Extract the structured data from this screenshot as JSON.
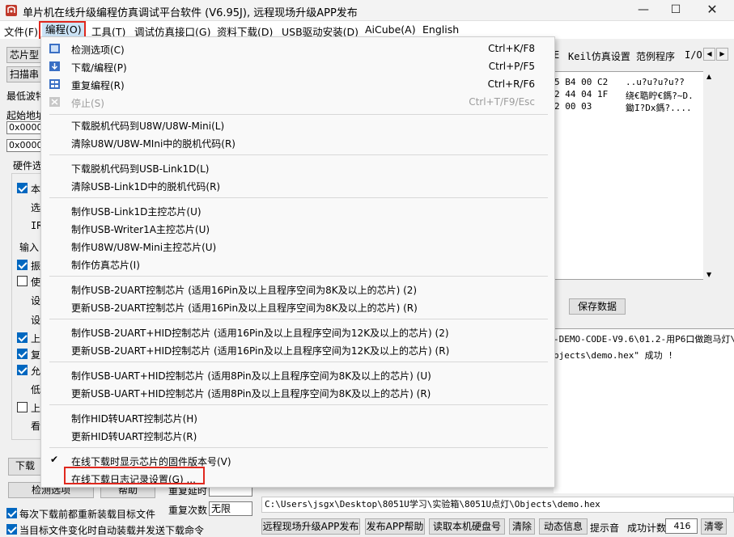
{
  "window": {
    "title": "单片机在线升级编程仿真调试平台软件 (V6.95J), 远程现场升级APP发布",
    "min_glyph": "—",
    "max_glyph": "☐",
    "close_glyph": "✕"
  },
  "menubar": [
    "文件(F)",
    "编程(O)",
    "工具(T)",
    "调试仿真接口(G)",
    "资料下载(D)",
    "USB驱动安装(D)",
    "AiCube(A)",
    "English"
  ],
  "left_panel": {
    "chip_label": "芯片型",
    "scan_label": "扫描串",
    "min_wave_label": "最低波特",
    "start_addr_label": "起始地址",
    "addr_value_1": "0x0000",
    "addr_value_2": "0x0000",
    "hardware_tab": "硬件选",
    "group_items": [
      "本",
      "选",
      "IR",
      "输入",
      "振",
      "使",
      "设",
      "设",
      "上",
      "复",
      "允",
      "低",
      "上",
      "看"
    ],
    "download_btn": "下载",
    "check_btn": "检测选项",
    "help_btn": "帮助",
    "retry_delay_label": "重复延时",
    "retry_count_label": "重复次数",
    "retry_count_value": "无限",
    "reload_each_label": "每次下载前都重新装载目标文件",
    "auto_reload_label": "当目标文件变化时自动装载并发送下载命令"
  },
  "right_panel": {
    "tabs": [
      "E",
      "Keil仿真设置",
      "范例程序",
      "I/O"
    ],
    "hex_rows": [
      {
        "hex": "5 B4 00 C2",
        "ascii": "..u?u?u?u??"
      },
      {
        "hex": "2 44 04 1F",
        "ascii": "绕€聕眝€鎷?~D."
      },
      {
        "hex": "2 00 03",
        "ascii": "鋤I?Dx鎷?...."
      }
    ],
    "save_button": "保存数据",
    "log_lines": [
      "-DEMO-CODE-V9.6\\01.2-用P6口做跑马灯\\",
      "bjects\\demo.hex\" 成功 !"
    ],
    "file_path": "C:\\Users\\jsgx\\Desktop\\8051U学习\\实验箱\\8051U点灯\\Objects\\demo.hex"
  },
  "bottom_bar": {
    "buttons": [
      "远程现场升级APP发布",
      "发布APP帮助",
      "读取本机硬盘号",
      "清除",
      "动态信息"
    ],
    "beep_label": "提示音",
    "success_label": "成功计数",
    "success_count": "416",
    "clear_button": "清零"
  },
  "dropdown": {
    "items": [
      {
        "label": "检测选项(C)",
        "shortcut": "Ctrl+K/F8",
        "icon": "detect-icon"
      },
      {
        "label": "下载/编程(P)",
        "shortcut": "Ctrl+P/F5",
        "icon": "download-icon"
      },
      {
        "label": "重复编程(R)",
        "shortcut": "Ctrl+R/F6",
        "icon": "repeat-icon"
      },
      {
        "label": "停止(S)",
        "shortcut": "Ctrl+T/F9/Esc",
        "icon": "stop-icon",
        "disabled": true
      },
      {
        "label": "下载脱机代码到U8W/U8W-Mini(L)"
      },
      {
        "label": "清除U8W/U8W-MIni中的脱机代码(R)"
      },
      {
        "label": "下载脱机代码到USB-Link1D(L)"
      },
      {
        "label": "清除USB-Link1D中的脱机代码(R)"
      },
      {
        "label": "制作USB-Link1D主控芯片(U)"
      },
      {
        "label": "制作USB-Writer1A主控芯片(U)"
      },
      {
        "label": "制作U8W/U8W-Mini主控芯片(U)"
      },
      {
        "label": "制作仿真芯片(I)"
      },
      {
        "label": "制作USB-2UART控制芯片 (适用16Pin及以上且程序空间为8K及以上的芯片) (2)"
      },
      {
        "label": "更新USB-2UART控制芯片 (适用16Pin及以上且程序空间为8K及以上的芯片) (R)"
      },
      {
        "label": "制作USB-2UART+HID控制芯片 (适用16Pin及以上且程序空间为12K及以上的芯片) (2)"
      },
      {
        "label": "更新USB-2UART+HID控制芯片 (适用16Pin及以上且程序空间为12K及以上的芯片) (R)"
      },
      {
        "label": "制作USB-UART+HID控制芯片 (适用8Pin及以上且程序空间为8K及以上的芯片) (U)"
      },
      {
        "label": "更新USB-UART+HID控制芯片 (适用8Pin及以上且程序空间为8K及以上的芯片) (R)"
      },
      {
        "label": "制作HID转UART控制芯片(H)"
      },
      {
        "label": "更新HID转UART控制芯片(R)"
      },
      {
        "label": "在线下载时显示芯片的固件版本号(V)",
        "checked": true
      },
      {
        "label": "在线下载日志记录设置(G) ..."
      }
    ]
  },
  "colors": {
    "highlight_box": "#e0281e",
    "checkbox_on": "#0067c0",
    "menu_active": "#cce4f7"
  }
}
